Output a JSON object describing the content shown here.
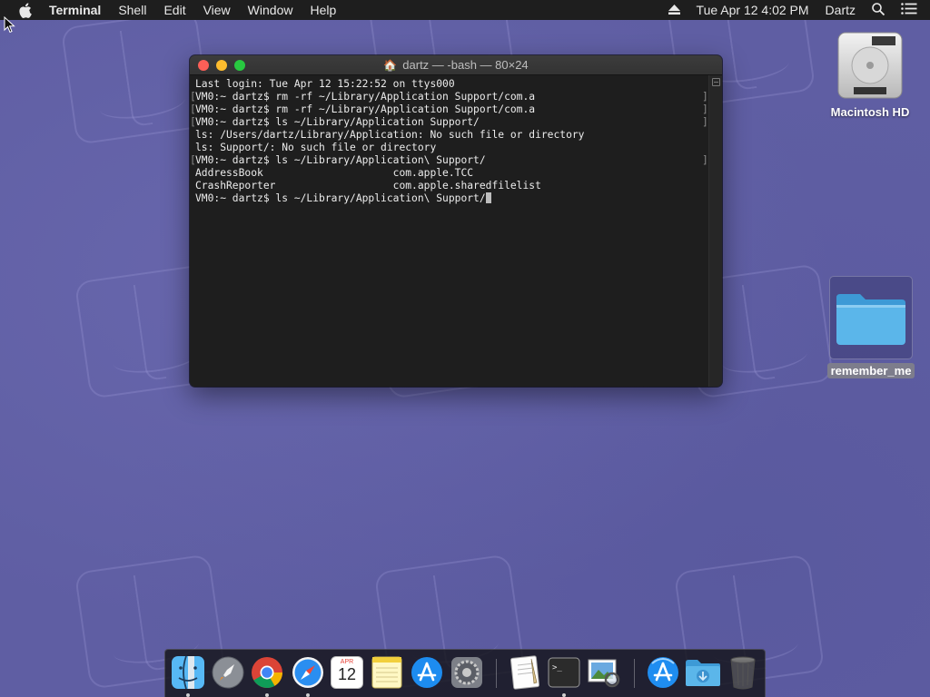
{
  "menubar": {
    "app_name": "Terminal",
    "items": [
      "Shell",
      "Edit",
      "View",
      "Window",
      "Help"
    ],
    "datetime": "Tue Apr 12  4:02 PM",
    "user": "Dartz"
  },
  "terminal": {
    "title": "dartz — -bash — 80×24",
    "lines": [
      "Last login: Tue Apr 12 15:22:52 on ttys000",
      "VM0:~ dartz$ rm -rf ~/Library/Application Support/com.a",
      "VM0:~ dartz$ rm -rf ~/Library/Application Support/com.a",
      "VM0:~ dartz$ ls ~/Library/Application Support/",
      "ls: /Users/dartz/Library/Application: No such file or directory",
      "ls: Support/: No such file or directory",
      "VM0:~ dartz$ ls ~/Library/Application\\ Support/",
      "AddressBook                     com.apple.TCC",
      "CrashReporter                   com.apple.sharedfilelist",
      "VM0:~ dartz$ ls ~/Library/Application\\ Support/"
    ]
  },
  "desktop": {
    "hd_label": "Macintosh HD",
    "folder_label": "remember_me"
  },
  "dock": {
    "apps": [
      {
        "icon": "finder-icon",
        "running": true
      },
      {
        "icon": "launchpad-icon",
        "running": false
      },
      {
        "icon": "chrome-icon",
        "running": true
      },
      {
        "icon": "safari-icon",
        "running": true
      },
      {
        "icon": "calendar-icon",
        "running": false,
        "month": "APR",
        "day": "12"
      },
      {
        "icon": "notes-icon",
        "running": false
      },
      {
        "icon": "app-store-icon",
        "running": false
      },
      {
        "icon": "system-preferences-icon",
        "running": false
      },
      {
        "icon": "textedit-icon",
        "running": false
      },
      {
        "icon": "terminal-icon",
        "running": true
      },
      {
        "icon": "preview-icon",
        "running": false
      },
      {
        "icon": "applications-folder-icon",
        "running": false
      },
      {
        "icon": "downloads-folder-icon",
        "running": false
      },
      {
        "icon": "trash-icon",
        "running": false
      }
    ]
  }
}
